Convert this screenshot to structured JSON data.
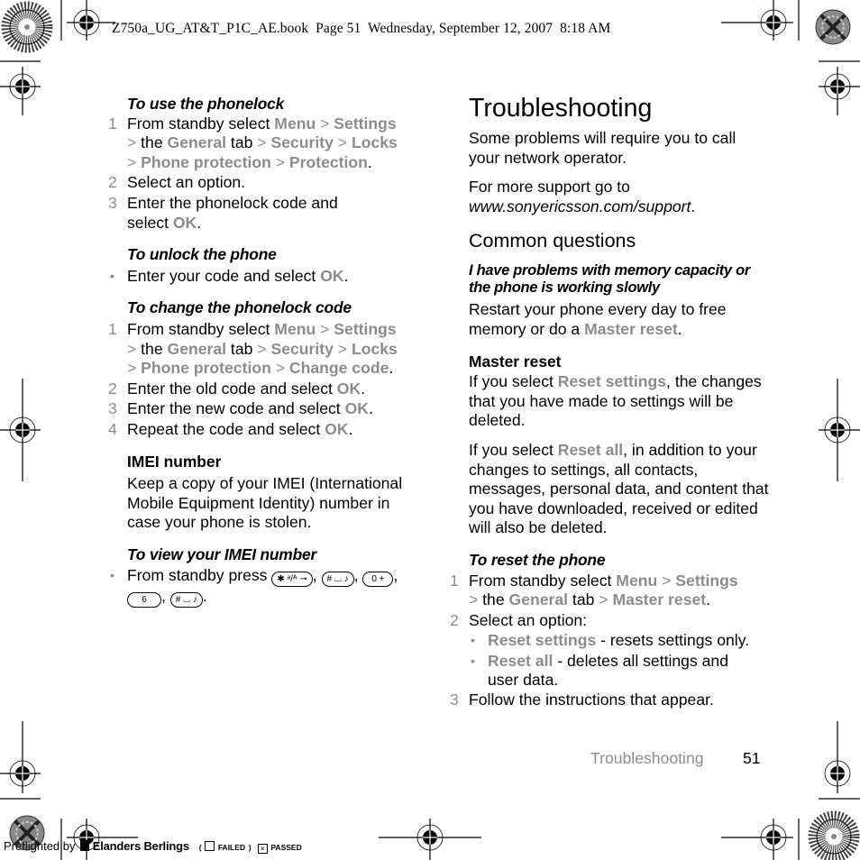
{
  "slug": "Z750a_UG_AT&T_P1C_AE.book  Page 51  Wednesday, September 12, 2007  8:18 AM",
  "left": {
    "phonelock": {
      "heading": "To use the phonelock",
      "step1": {
        "num": "1",
        "t1": "From standby select ",
        "menu": "Menu",
        "sep": " > ",
        "settings": "Settings",
        "the": " the ",
        "general": "General",
        "tab": " tab ",
        "security": "Security",
        "locks": "Locks",
        "phone_protection": "Phone protection",
        "protection": "Protection",
        "end": "."
      },
      "step2": {
        "num": "2",
        "text": "Select an option."
      },
      "step3": {
        "num": "3",
        "text": "Enter the phonelock code and",
        "text2": "select ",
        "ok": "OK",
        "end": "."
      }
    },
    "unlock": {
      "heading": "To unlock the phone",
      "bullet": "•",
      "text": "Enter your code and select ",
      "ok": "OK",
      "end": "."
    },
    "change": {
      "heading": "To change the phonelock code",
      "step1": {
        "num": "1",
        "t1": "From standby select ",
        "menu": "Menu",
        "settings": "Settings",
        "the": " the ",
        "general": "General",
        "tab": " tab ",
        "security": "Security",
        "locks": "Locks",
        "phone_protection": "Phone protection",
        "change_code": "Change code",
        "end": "."
      },
      "step2": {
        "num": "2",
        "text": "Enter the old code and select ",
        "ok": "OK",
        "end": "."
      },
      "step3": {
        "num": "3",
        "text": "Enter the new code and select ",
        "ok": "OK",
        "end": "."
      },
      "step4": {
        "num": "4",
        "text": "Repeat the code and select ",
        "ok": "OK",
        "end": "."
      }
    },
    "imei": {
      "heading": "IMEI number",
      "body": "Keep a copy of your IMEI (International Mobile Equipment Identity) number in case your phone is stolen."
    },
    "view_imei": {
      "heading": "To view your IMEI number",
      "bullet": "•",
      "text": "From standby press ",
      "keys": [
        "✱ ᵃ/ᴬ ⊸",
        "# ⌴ ♪",
        "0 +",
        "6",
        "# ⌴ ♪"
      ],
      "comma": ", ",
      "end": "."
    }
  },
  "right": {
    "title": "Troubleshooting",
    "intro1": "Some problems will require you to call your network operator.",
    "intro2_a": "For more support go to",
    "intro2_link": "www.sonyericsson.com/support",
    "intro2_end": ".",
    "common": "Common questions",
    "question": "I have problems with memory capacity or the phone is working slowly",
    "answer_a": "Restart your phone every day to free memory or do a ",
    "answer_link": "Master reset",
    "answer_end": ".",
    "master_heading": "Master reset",
    "master_p1_a": "If you select ",
    "master_p1_link": "Reset settings",
    "master_p1_b": ", the changes that you have made to settings will be deleted.",
    "master_p2_a": "If you select ",
    "master_p2_link": "Reset all",
    "master_p2_b": ", in addition to your changes to settings, all contacts, messages, personal data, and content that you have downloaded, received or edited will also be deleted.",
    "reset": {
      "heading": "To reset the phone",
      "step1": {
        "num": "1",
        "t1": "From standby select ",
        "menu": "Menu",
        "settings": "Settings",
        "the": " the ",
        "general": "General",
        "tab": " tab ",
        "master_reset": "Master reset",
        "end": "."
      },
      "step2": {
        "num": "2",
        "text": "Select an option:"
      },
      "sub1": {
        "bullet": "•",
        "link": "Reset settings",
        "text": " - resets settings only."
      },
      "sub2": {
        "bullet": "•",
        "link": "Reset all",
        "text": " - deletes all settings and user data."
      },
      "step3": {
        "num": "3",
        "text": "Follow the instructions that appear."
      }
    }
  },
  "footer": {
    "section": "Troubleshooting",
    "page": "51"
  },
  "preflight": {
    "by": "Preflighted by",
    "brand": "Elanders Berlings",
    "open": "(",
    "failed": "FAILED",
    "close": ")",
    "passed": "PASSED",
    "passed_mark": "×"
  },
  "colors": {
    "menu_gray": "#8c8c8c",
    "text": "#000000"
  }
}
